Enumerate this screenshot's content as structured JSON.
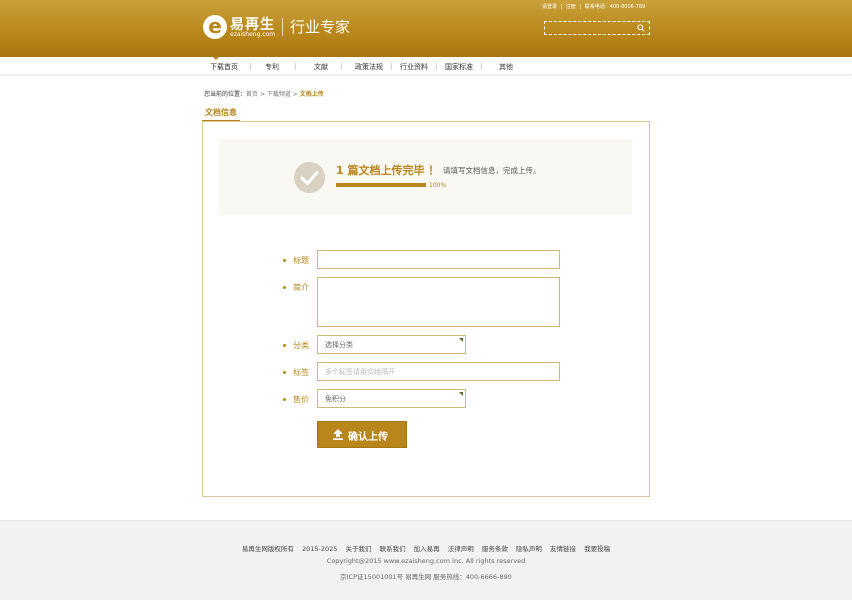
{
  "header": {
    "logo_letter": "e",
    "logo_name": "易再生",
    "logo_url": "ezaisheng.com",
    "slogan": "行业专家",
    "top_links": [
      "请登录",
      "|",
      "注册",
      "|",
      "联系电话：400-8006-789"
    ],
    "search_placeholder": ""
  },
  "nav": {
    "items": [
      "下载首页",
      "专利",
      "文献",
      "政策法规",
      "行业资料",
      "国家标准",
      "其他"
    ],
    "active": "下载首页"
  },
  "breadcrumb": {
    "label": "您当前的位置：",
    "home": "首页",
    "sep1": " > ",
    "section": "下载频道",
    "sep2": " > ",
    "current": "文档上传"
  },
  "section_tab": "文档信息",
  "banner": {
    "title": "1  篇文档上传完毕 ！",
    "subtitle": "请填写文档信息，完成上传。",
    "progress": 1.0,
    "progress_text": "100%"
  },
  "form": {
    "title_label": "标题",
    "title_value": "",
    "desc_label": "简介",
    "desc_value": "",
    "category_label": "分类",
    "category_value": "选择分类",
    "tags_label": "标签",
    "tags_placeholder": "多个标签请用空格隔开",
    "price_label": "售价",
    "price_value": "免积分",
    "submit_label": "确认上传"
  },
  "footer": {
    "links": [
      "易再生网版权所有",
      "2015-2025",
      "关于我们",
      "联系我们",
      "加入易再",
      "法律声明",
      "服务条款",
      "隐私声明",
      "友情链接",
      "我要投稿"
    ],
    "copyright": "Copyright@2015 www.ezaisheng.com Inc. All rights reserved",
    "icp": "京ICP证15001001号 易再生网 服务热线：400-6666-890"
  },
  "colors": {
    "brand": "#b8861a",
    "header_gradient_top": "#c9a13a",
    "footer_bg": "#f2f2f2"
  }
}
